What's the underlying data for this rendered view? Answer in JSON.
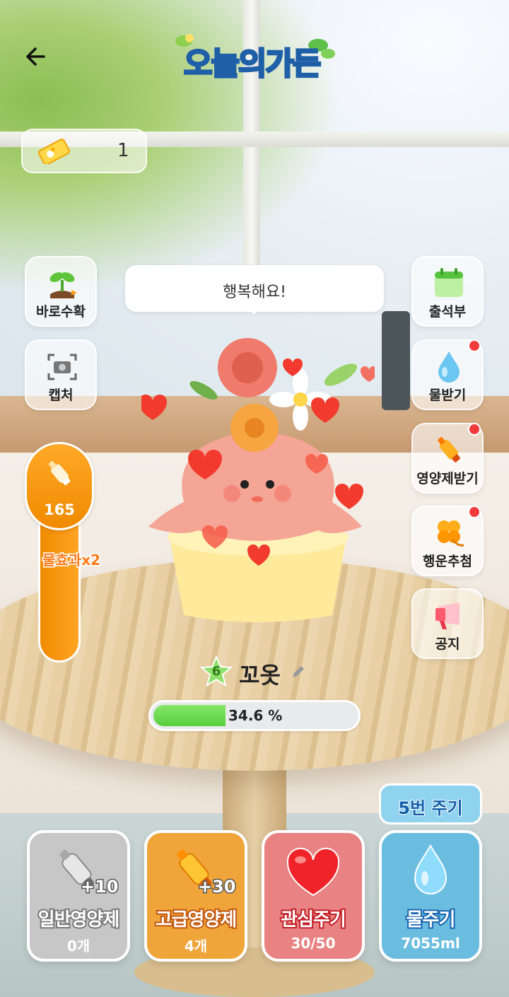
{
  "header": {
    "back_icon": "back-arrow-icon",
    "logo_text": "오늘의가든"
  },
  "ticket": {
    "icon": "lucky-ticket-icon",
    "count": "1"
  },
  "left_menu": [
    {
      "label": "바로수확",
      "icon": "sprout-icon"
    },
    {
      "label": "캡처",
      "icon": "camera-icon"
    }
  ],
  "right_menu": [
    {
      "label": "출석부",
      "icon": "calendar-icon",
      "badge": false
    },
    {
      "label": "물받기",
      "icon": "water-drop-icon",
      "badge": true
    },
    {
      "label": "영양제받기",
      "icon": "nutrient-bottle-icon",
      "badge": true
    },
    {
      "label": "행운추첨",
      "icon": "clover-icon",
      "badge": true
    },
    {
      "label": "공지",
      "icon": "notice-icon",
      "badge": false
    }
  ],
  "speech": "행복해요!",
  "water_gauge": {
    "value": "165",
    "effect_label": "물효과x2",
    "icon": "nutrient-bottle-icon"
  },
  "plant": {
    "level": "6",
    "name": "꼬옷",
    "progress_text": "34.6 %",
    "progress": 0.346
  },
  "cycle_badge": "5번 주기",
  "actions": [
    {
      "label": "일반영양제",
      "sub": "0개",
      "plus": "+10",
      "icon": "gray-bottle-icon",
      "bg": "#c7c7c7",
      "stroke": "#7a7a7a"
    },
    {
      "label": "고급영양제",
      "sub": "4개",
      "plus": "+30",
      "icon": "gold-bottle-icon",
      "bg": "#f0a53a",
      "stroke": "#c2560f"
    },
    {
      "label": "관심주기",
      "sub": "30/50",
      "plus": "",
      "icon": "heart-icon",
      "bg": "#e98383",
      "stroke": "#c41f27"
    },
    {
      "label": "물주기",
      "sub": "7055ml",
      "plus": "",
      "icon": "water-drop-icon",
      "bg": "#6bbde0",
      "stroke": "#1a67b3"
    }
  ],
  "colors": {
    "accent_orange": "#f08a00",
    "progress_green": "#58cf3d",
    "badge_red": "#f23b3b"
  }
}
